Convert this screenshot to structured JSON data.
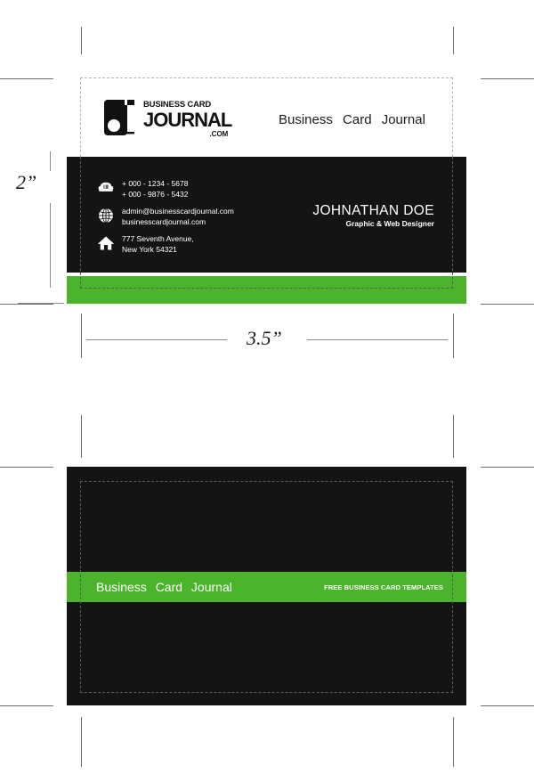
{
  "document": {
    "title": "Business Card Journal — Free Business Card Template Preview",
    "background_color": "#ffffff"
  },
  "colors": {
    "green": "#4CB42C",
    "black": "#141414",
    "white": "#ffffff",
    "guide_light": "#b4b4b4",
    "guide_dark": "#5a5a5a",
    "crop_mark": "#6e6e6e"
  },
  "dimensions": {
    "height_label": "2”",
    "width_label": "3.5”"
  },
  "logo": {
    "line1": "BUSINESS CARD",
    "line2": "JOURNAL",
    "line3": ".COM",
    "mark_icon": "journal-j-mark-icon"
  },
  "front_card": {
    "brand_words": "Business  Card  Journal",
    "contacts": [
      {
        "icon": "telephone-icon",
        "lines": [
          "+ 000 - 1234 - 5678",
          "+ 000 - 9876 - 5432"
        ]
      },
      {
        "icon": "globe-icon",
        "lines": [
          "admin@businesscardjournal.com",
          "businesscardjournal.com"
        ]
      },
      {
        "icon": "home-icon",
        "lines": [
          "777 Seventh Avenue,",
          "New York 54321"
        ]
      }
    ],
    "person": {
      "name": "JOHNATHAN DOE",
      "role": "Graphic & Web Designer"
    }
  },
  "back_card": {
    "brand_words": "Business  Card  Journal",
    "tagline": "FREE BUSINESS CARD TEMPLATES"
  }
}
